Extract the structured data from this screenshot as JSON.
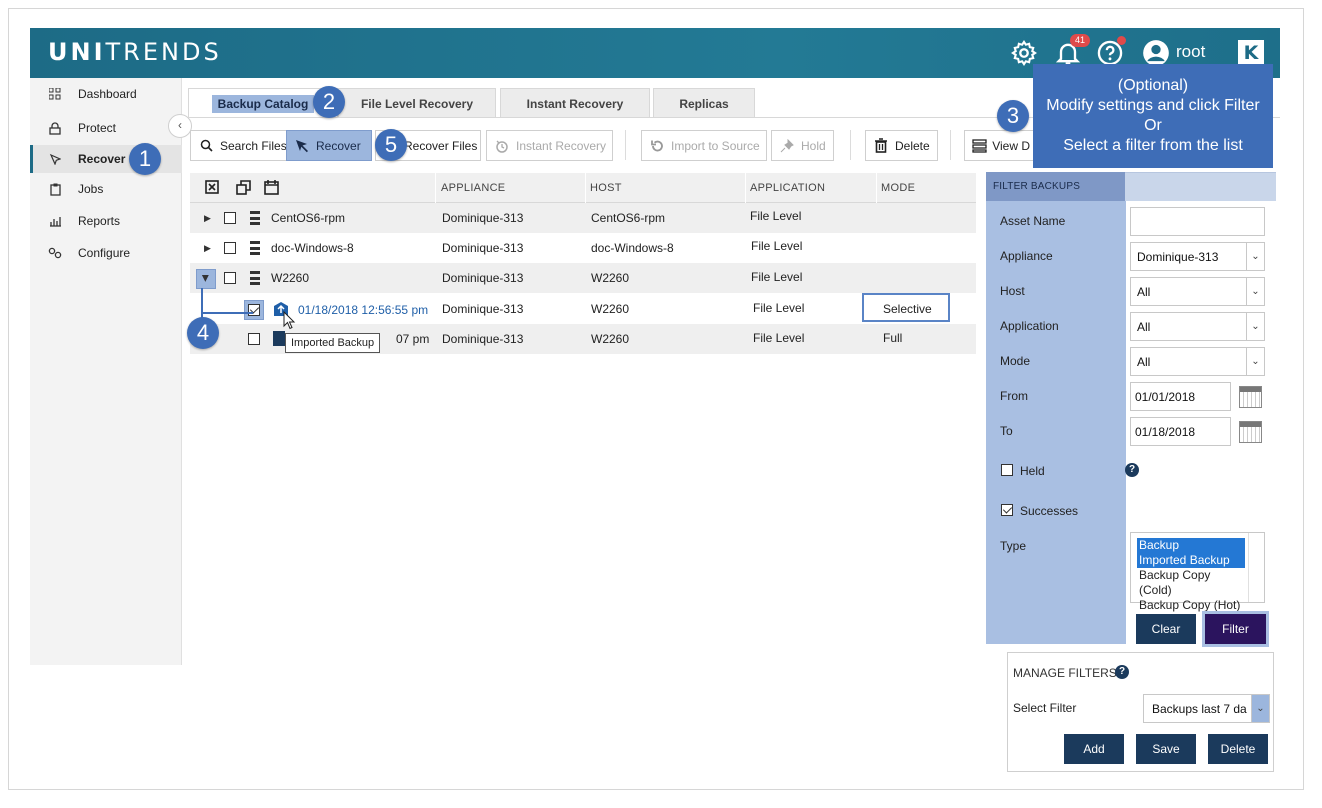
{
  "header": {
    "logo_bold": "UNI",
    "logo_light": "TRENDS",
    "notif_count": "41",
    "user": "root",
    "k_logo": "K"
  },
  "sidebar": {
    "items": [
      {
        "label": "Dashboard",
        "icon": "grid-icon"
      },
      {
        "label": "Protect",
        "icon": "lock-icon"
      },
      {
        "label": "Recover",
        "icon": "cursor-icon"
      },
      {
        "label": "Jobs",
        "icon": "clipboard-icon"
      },
      {
        "label": "Reports",
        "icon": "chart-icon"
      },
      {
        "label": "Configure",
        "icon": "gears-icon"
      }
    ]
  },
  "callouts": [
    "1",
    "2",
    "3",
    "4",
    "5"
  ],
  "tabs": [
    "Backup Catalog",
    "File Level Recovery",
    "Instant Recovery",
    "Replicas"
  ],
  "toolbar": {
    "search_files": "Search Files",
    "recover": "Recover",
    "recover_files": "Recover Files",
    "instant_recovery": "Instant Recovery",
    "import_to_source": "Import to Source",
    "hold": "Hold",
    "delete": "Delete",
    "view_d": "View D"
  },
  "grid": {
    "columns": [
      "APPLIANCE",
      "HOST",
      "APPLICATION",
      "MODE"
    ],
    "rows": [
      {
        "name": "CentOS6-rpm",
        "appliance": "Dominique-313",
        "host": "CentOS6-rpm",
        "application": "File Level",
        "mode": ""
      },
      {
        "name": "doc-Windows-8",
        "appliance": "Dominique-313",
        "host": "doc-Windows-8",
        "application": "File Level",
        "mode": ""
      },
      {
        "name": "W2260",
        "appliance": "Dominique-313",
        "host": "W2260",
        "application": "File Level",
        "mode": ""
      },
      {
        "name": "01/18/2018 12:56:55 pm",
        "appliance": "Dominique-313",
        "host": "W2260",
        "application": "File Level",
        "mode": "Selective"
      },
      {
        "name": "07 pm",
        "appliance": "Dominique-313",
        "host": "W2260",
        "application": "File Level",
        "mode": "Full"
      }
    ],
    "tooltip": "Imported Backup"
  },
  "info_box": {
    "line1": "(Optional)",
    "line2": "Modify settings and click Filter",
    "line3": "Or",
    "line4": "Select a filter from the list"
  },
  "filter": {
    "title": "FILTER BACKUPS",
    "asset_name_label": "Asset Name",
    "asset_name_value": "",
    "appliance_label": "Appliance",
    "appliance_value": "Dominique-313",
    "host_label": "Host",
    "host_value": "All",
    "application_label": "Application",
    "application_value": "All",
    "mode_label": "Mode",
    "mode_value": "All",
    "from_label": "From",
    "from_value": "01/01/2018",
    "to_label": "To",
    "to_value": "01/18/2018",
    "held_label": "Held",
    "successes_label": "Successes",
    "type_label": "Type",
    "type_options": [
      "Backup",
      "Imported Backup",
      "Backup Copy (Cold)",
      "Backup Copy (Hot)"
    ],
    "clear": "Clear",
    "filter": "Filter"
  },
  "manage_filters": {
    "title": "MANAGE FILTERS",
    "select_label": "Select Filter",
    "select_value": "Backups last 7 da",
    "add": "Add",
    "save": "Save",
    "delete": "Delete"
  }
}
